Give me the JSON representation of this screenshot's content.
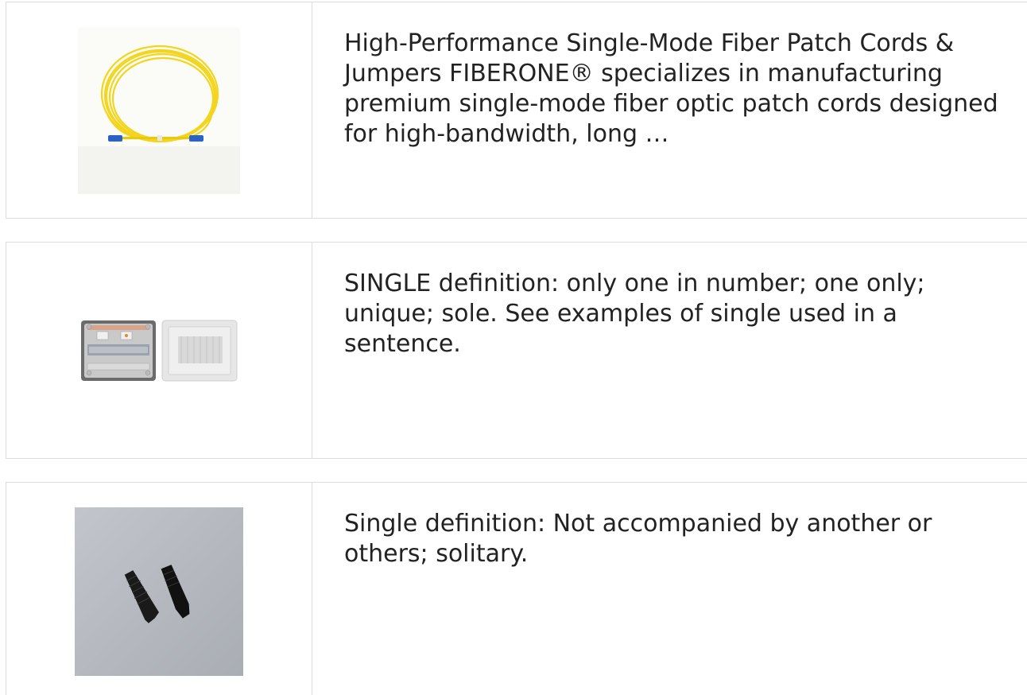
{
  "results": [
    {
      "image_alt": "yellow single-mode fiber patch cord",
      "description": "High-Performance Single-Mode Fiber Patch Cords & Jumpers FIBERONE® specializes in manufacturing premium single-mode fiber optic patch cords designed for high-bandwidth, long …"
    },
    {
      "image_alt": "grey electrical distribution box",
      "description": "SINGLE definition: only one in number; one only; unique; sole. See examples of single used in a sentence."
    },
    {
      "image_alt": "black connector boots on grey background",
      "description": "Single definition: Not accompanied by another or others; solitary."
    }
  ],
  "colors": {
    "border": "#dcdcdc",
    "text": "#222222",
    "cable_yellow": "#f2d51c",
    "connector_blue": "#2b63c4",
    "photo_grey": "#b4b8bf"
  }
}
